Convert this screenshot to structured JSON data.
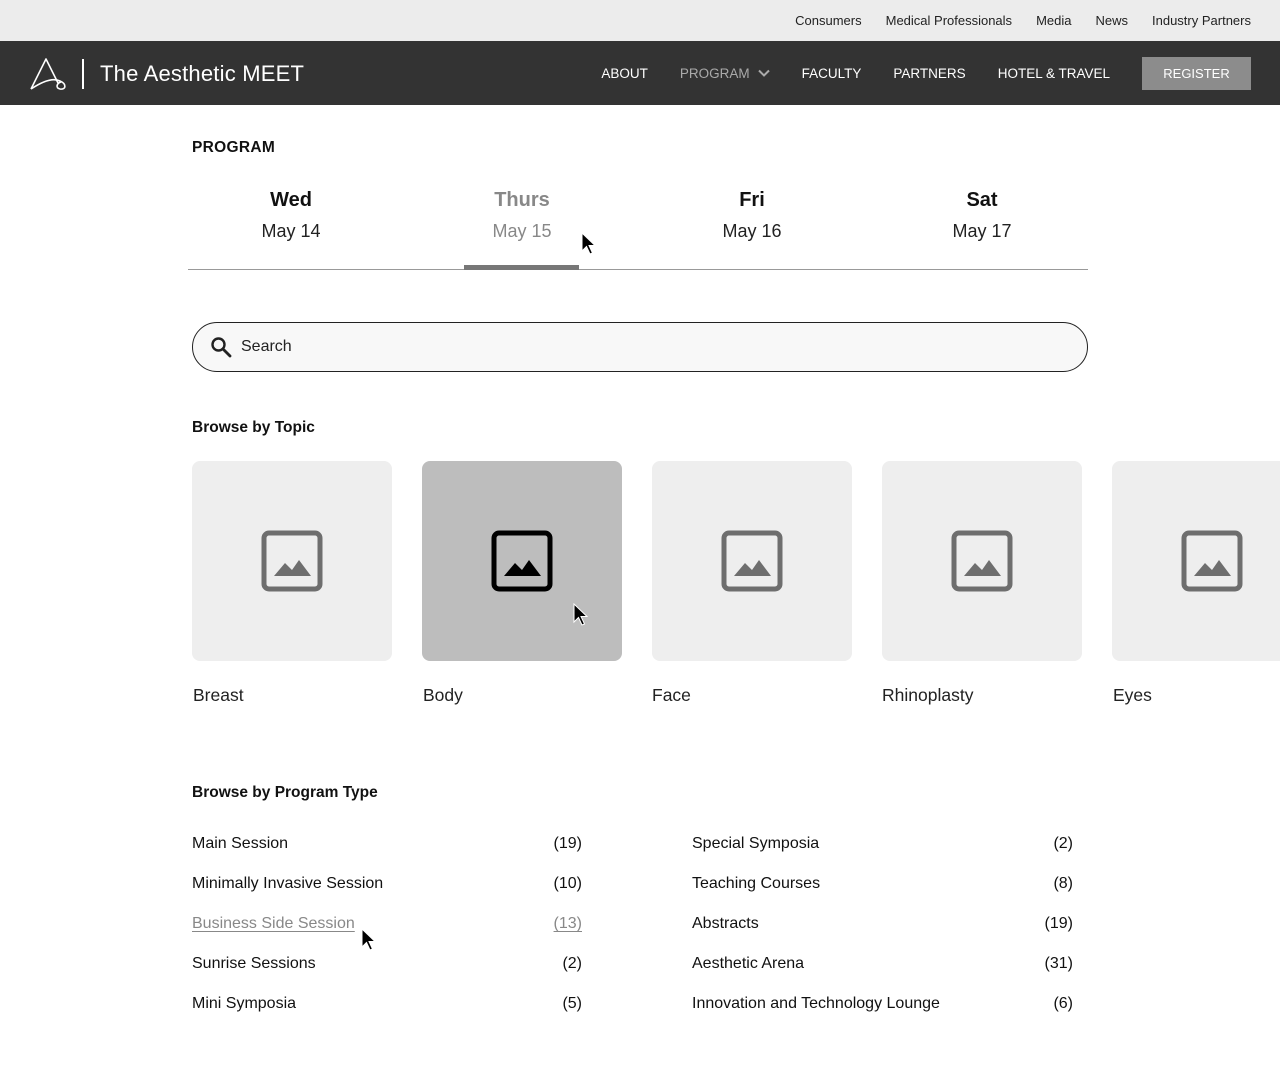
{
  "utility_nav": {
    "links": [
      "Consumers",
      "Medical Professionals",
      "Media",
      "News",
      "Industry Partners"
    ]
  },
  "header": {
    "brand_name": "The Aesthetic MEET",
    "nav_items": [
      {
        "label": "ABOUT",
        "active": false
      },
      {
        "label": "PROGRAM",
        "active": true,
        "has_dropdown": true
      },
      {
        "label": "FACULTY",
        "active": false
      },
      {
        "label": "PARTNERS",
        "active": false
      },
      {
        "label": "HOTEL & TRAVEL",
        "active": false
      }
    ],
    "register_label": "REGISTER"
  },
  "program": {
    "title": "PROGRAM",
    "days": [
      {
        "dow": "Wed",
        "date": "May 14"
      },
      {
        "dow": "Thurs",
        "date": "May 15"
      },
      {
        "dow": "Fri",
        "date": "May 16"
      },
      {
        "dow": "Sat",
        "date": "May 17"
      }
    ],
    "selected_day": 1
  },
  "search": {
    "placeholder": "Search",
    "value": ""
  },
  "topics": {
    "title": "Browse by Topic",
    "items": [
      {
        "label": "Breast"
      },
      {
        "label": "Body"
      },
      {
        "label": "Face"
      },
      {
        "label": "Rhinoplasty"
      },
      {
        "label": "Eyes"
      }
    ],
    "hovered_index": 1
  },
  "program_types": {
    "title": "Browse by Program Type",
    "left": [
      {
        "label": "Main Session",
        "count": "(19)"
      },
      {
        "label": "Minimally Invasive Session",
        "count": "(10)"
      },
      {
        "label": "Business Side Session",
        "count": "(13)"
      },
      {
        "label": "Sunrise Sessions",
        "count": "(2)"
      },
      {
        "label": "Mini Symposia",
        "count": "(5)"
      }
    ],
    "right": [
      {
        "label": "Special Symposia",
        "count": "(2)"
      },
      {
        "label": "Teaching Courses",
        "count": "(8)"
      },
      {
        "label": "Abstracts",
        "count": "(19)"
      },
      {
        "label": "Aesthetic Arena",
        "count": "(31)"
      },
      {
        "label": "Innovation and Technology Lounge",
        "count": "(6)"
      }
    ],
    "hovered_left_index": 2
  },
  "colors": {
    "nav_background": "#333333",
    "utility_background": "#ececec",
    "register_background": "#8c8c8c",
    "tile_background": "#eeeeee",
    "tile_hover_background": "#bdbdbd",
    "muted_text": "#888888"
  },
  "icons": [
    "brand-logo-icon",
    "chevron-down-icon",
    "search-icon",
    "image-placeholder-icon",
    "mouse-cursor-icon"
  ]
}
